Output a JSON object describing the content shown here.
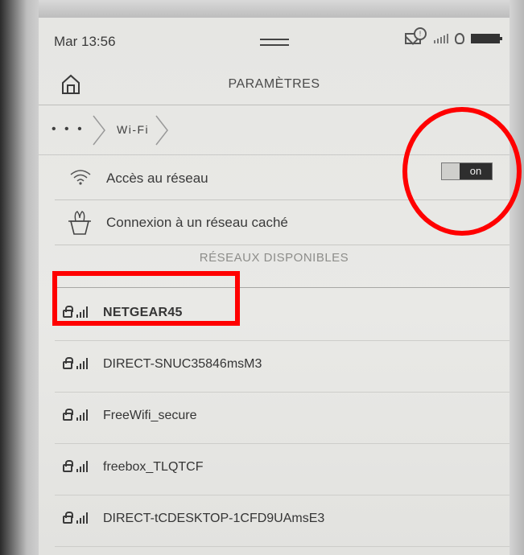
{
  "status_bar": {
    "time": "Mar 13:56",
    "icons": [
      "mail-icon",
      "notification-icon",
      "signal-icon",
      "frontlight-icon",
      "battery-icon"
    ]
  },
  "header": {
    "title": "PARAMÈTRES",
    "home_icon": "home-icon"
  },
  "breadcrumb": {
    "items": [
      "• • •",
      "Wi-Fi"
    ]
  },
  "settings": {
    "network_access_label": "Accès au réseau",
    "network_access_toggle": "on",
    "hidden_network_label": "Connexion à un réseau caché"
  },
  "available_networks": {
    "header": "RÉSEAUX DISPONIBLES",
    "items": [
      {
        "name": "NETGEAR45",
        "secured": true
      },
      {
        "name": "DIRECT-SNUC35846msM3",
        "secured": true
      },
      {
        "name": "FreeWifi_secure",
        "secured": true
      },
      {
        "name": "freebox_TLQTCF",
        "secured": true
      },
      {
        "name": "DIRECT-tCDESKTOP-1CFD9UAmsE3",
        "secured": true
      }
    ]
  },
  "annotation_color": "#ff0000"
}
